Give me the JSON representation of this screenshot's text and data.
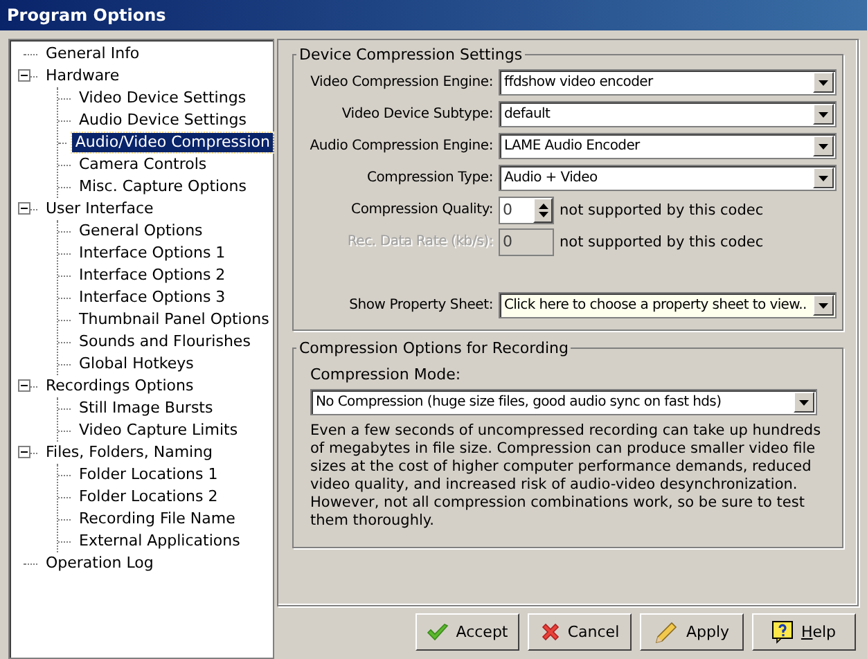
{
  "window": {
    "title": "Program Options"
  },
  "tree": [
    {
      "label": "General Info",
      "selected": false
    },
    {
      "label": "Hardware",
      "selected": false,
      "expanded": true,
      "children": [
        {
          "label": "Video Device Settings",
          "selected": false
        },
        {
          "label": "Audio Device Settings",
          "selected": false
        },
        {
          "label": "Audio/Video Compression",
          "selected": true
        },
        {
          "label": "Camera Controls",
          "selected": false
        },
        {
          "label": "Misc. Capture Options",
          "selected": false
        }
      ]
    },
    {
      "label": "User Interface",
      "selected": false,
      "expanded": true,
      "children": [
        {
          "label": "General Options",
          "selected": false
        },
        {
          "label": "Interface Options 1",
          "selected": false
        },
        {
          "label": "Interface Options 2",
          "selected": false
        },
        {
          "label": "Interface Options 3",
          "selected": false
        },
        {
          "label": "Thumbnail Panel Options",
          "selected": false
        },
        {
          "label": "Sounds and Flourishes",
          "selected": false
        },
        {
          "label": "Global Hotkeys",
          "selected": false
        }
      ]
    },
    {
      "label": "Recordings Options",
      "selected": false,
      "expanded": true,
      "children": [
        {
          "label": "Still Image Bursts",
          "selected": false
        },
        {
          "label": "Video Capture Limits",
          "selected": false
        }
      ]
    },
    {
      "label": "Files, Folders, Naming",
      "selected": false,
      "expanded": true,
      "children": [
        {
          "label": "Folder Locations 1",
          "selected": false
        },
        {
          "label": "Folder Locations 2",
          "selected": false
        },
        {
          "label": "Recording File Name",
          "selected": false
        },
        {
          "label": "External Applications",
          "selected": false
        }
      ]
    },
    {
      "label": "Operation Log",
      "selected": false
    }
  ],
  "device_group": {
    "title": "Device Compression Settings",
    "rows": [
      {
        "kind": "combo",
        "label": "Video Compression Engine:",
        "value": "ffdshow video encoder",
        "disabled": false
      },
      {
        "kind": "combo",
        "label": "Video Device Subtype:",
        "value": "default",
        "disabled": false
      },
      {
        "kind": "combo",
        "label": "Audio Compression Engine:",
        "value": "LAME Audio Encoder",
        "disabled": false
      },
      {
        "kind": "combo",
        "label": "Compression Type:",
        "value": "Audio + Video",
        "disabled": false
      },
      {
        "kind": "spin",
        "label": "Compression Quality:",
        "value": "0",
        "note": "not supported by this codec",
        "disabled": false
      },
      {
        "kind": "text",
        "label": "Rec. Data Rate (kb/s):",
        "value": "0",
        "note": "not supported by this codec",
        "disabled": true
      },
      {
        "kind": "gap"
      },
      {
        "kind": "combo",
        "label": "Show Property Sheet:",
        "value": "Click here to choose a property sheet to view..",
        "disabled": false,
        "highlight": true
      }
    ]
  },
  "recording_group": {
    "title": "Compression Options for Recording",
    "mode_label": "Compression Mode:",
    "mode_value": "No Compression (huge size files, good audio sync on fast hds)",
    "description": "Even a few seconds of uncompressed recording can take up hundreds of megabytes in file size.  Compression can produce smaller video file sizes at the cost of higher computer performance demands, reduced video quality, and increased risk of audio-video desynchronization.  However, not all compression combinations work, so be sure to test them thoroughly."
  },
  "buttons": [
    {
      "kind": "accept",
      "label": "Accept",
      "first_letter_underlined": false
    },
    {
      "kind": "cancel",
      "label": "Cancel",
      "first_letter_underlined": false
    },
    {
      "kind": "apply",
      "label": "Apply",
      "first_letter_underlined": false
    },
    {
      "kind": "help",
      "label": "Help",
      "first_letter_underlined": true
    }
  ]
}
